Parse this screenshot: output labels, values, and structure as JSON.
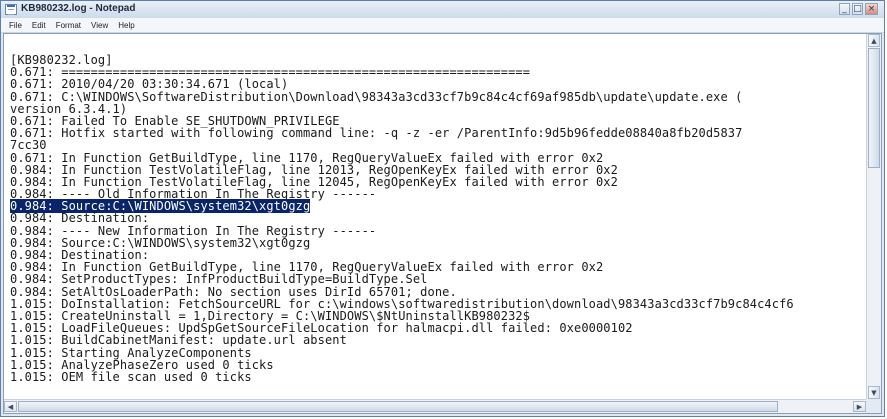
{
  "window": {
    "title": "KB980232.log - Notepad",
    "controls": {
      "minimize": "_",
      "maximize": "□",
      "close": "×"
    }
  },
  "menu": [
    "File",
    "Edit",
    "Format",
    "View",
    "Help"
  ],
  "editor": {
    "selected_line_index": 12,
    "lines": [
      "[KB980232.log]",
      "0.671: ================================================================",
      "0.671: 2010/04/20 03:30:34.671 (local)",
      "0.671: C:\\WINDOWS\\SoftwareDistribution\\Download\\98343a3cd33cf7b9c84c4cf69af985db\\update\\update.exe (",
      "version 6.3.4.1)",
      "0.671: Failed To Enable SE_SHUTDOWN_PRIVILEGE",
      "0.671: Hotfix started with following command line: -q -z -er /ParentInfo:9d5b96fedde08840a8fb20d5837",
      "7cc30",
      "0.671: In Function GetBuildType, line 1170, RegQueryValueEx failed with error 0x2",
      "0.984: In Function TestVolatileFlag, line 12013, RegOpenKeyEx failed with error 0x2",
      "0.984: In Function TestVolatileFlag, line 12045, RegOpenKeyEx failed with error 0x2",
      "0.984: ---- Old Information In The Registry ------",
      "0.984: Source:C:\\WINDOWS\\system32\\xgt0gzg",
      "0.984: Destination:",
      "0.984: ---- New Information In The Registry ------",
      "0.984: Source:C:\\WINDOWS\\system32\\xgt0gzg",
      "0.984: Destination:",
      "0.984: In Function GetBuildType, line 1170, RegQueryValueEx failed with error 0x2",
      "0.984: SetProductTypes: InfProductBuildType=BuildType.Sel",
      "0.984: SetAltOsLoaderPath: No section uses DirId 65701; done.",
      "1.015: DoInstallation: FetchSourceURL for c:\\windows\\softwaredistribution\\download\\98343a3cd33cf7b9c84c4cf6",
      "1.015: CreateUninstall = 1,Directory = C:\\WINDOWS\\$NtUninstallKB980232$",
      "1.015: LoadFileQueues: UpdSpGetSourceFileLocation for halmacpi.dll failed: 0xe0000102",
      "1.015: BuildCabinetManifest: update.url absent",
      "1.015: Starting AnalyzeComponents",
      "1.015: AnalyzePhaseZero used 0 ticks",
      "1.015: OEM file scan used 0 ticks"
    ]
  },
  "scrollbars": {
    "vertical": {
      "up": "▲",
      "down": "▼"
    },
    "horizontal": {
      "left": "◀",
      "right": "▶"
    }
  }
}
